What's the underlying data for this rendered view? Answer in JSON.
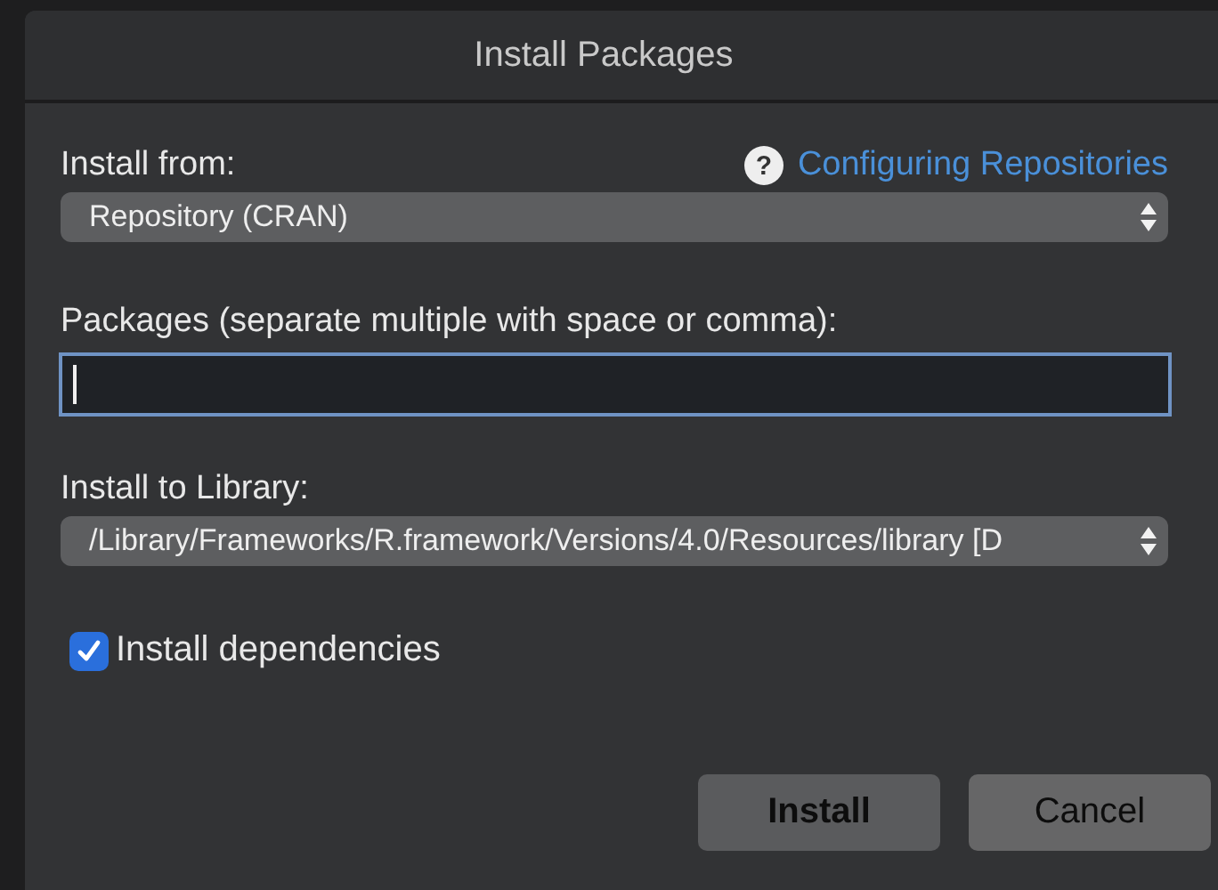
{
  "window": {
    "title": "Install Packages"
  },
  "install_from": {
    "label": "Install from:",
    "help_icon": "?",
    "help_link": "Configuring Repositories",
    "value": "Repository (CRAN)"
  },
  "packages": {
    "label": "Packages (separate multiple with space or comma):",
    "focused": true
  },
  "library": {
    "label": "Install to Library:",
    "value": "/Library/Frameworks/R.framework/Versions/4.0/Resources/library [D"
  },
  "dependencies": {
    "label": "Install dependencies",
    "checked": true
  },
  "buttons": [
    {
      "label": "Install",
      "default": true
    },
    {
      "label": "Cancel",
      "default": false
    }
  ]
}
